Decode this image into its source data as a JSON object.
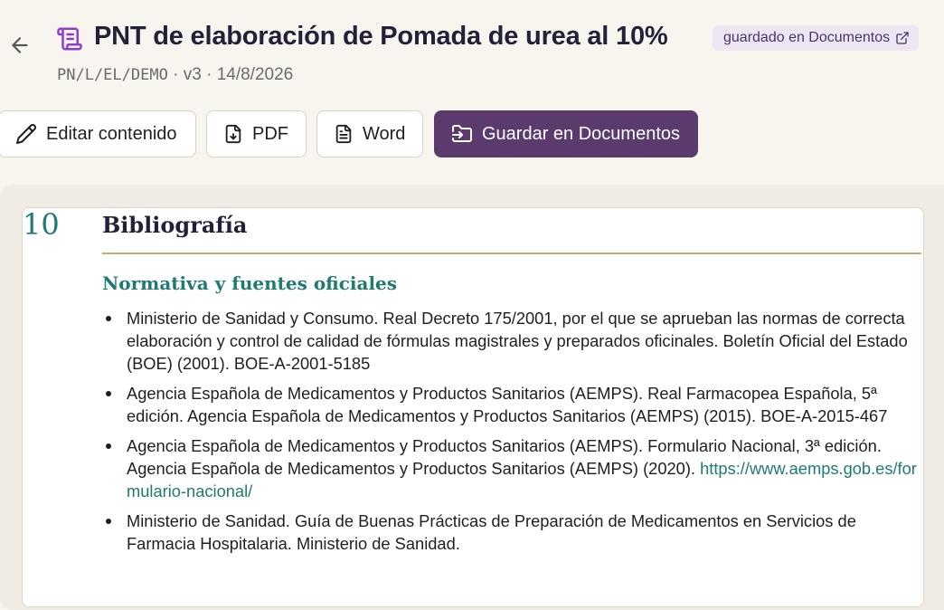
{
  "header": {
    "title": "PNT de elaboración de Pomada de urea al 10%",
    "saved_badge": "guardado en Documentos",
    "code": "PN/L/EL/DEMO",
    "version": "v3",
    "date": "14/8/2026",
    "separator": "·"
  },
  "toolbar": {
    "edit_label": "Editar contenido",
    "pdf_label": "PDF",
    "word_label": "Word",
    "save_label": "Guardar en Documentos"
  },
  "section": {
    "number": "10",
    "title": "Bibliografía",
    "subsection_title": "Normativa y fuentes oficiales",
    "references": [
      {
        "text": "Ministerio de Sanidad y Consumo. Real Decreto 175/2001, por el que se aprueban las normas de correcta elaboración y control de calidad de fórmulas magistrales y preparados oficinales. Boletín Oficial del Estado (BOE) (2001). BOE-A-2001-5185"
      },
      {
        "text": "Agencia Española de Medicamentos y Productos Sanitarios (AEMPS). Real Farmacopea Española, 5ª edición. Agencia Española de Medicamentos y Productos Sanitarios (AEMPS) (2015). BOE-A-2015-467"
      },
      {
        "text": "Agencia Española de Medicamentos y Productos Sanitarios (AEMPS). Formulario Nacional, 3ª edición. Agencia Española de Medicamentos y Productos Sanitarios (AEMPS) (2020). ",
        "link": "https://www.aemps.gob.es/formulario-nacional/"
      },
      {
        "text": "Ministerio de Sanidad. Guía de Buenas Prácticas de Preparación de Medicamentos en Servicios de Farmacia Hospitalaria. Ministerio de Sanidad."
      }
    ]
  },
  "icons": {
    "back": "arrow-left-icon",
    "document": "scroll-icon",
    "external": "external-link-icon",
    "edit": "pencil-icon",
    "pdf": "file-download-icon",
    "word": "file-text-icon",
    "save": "folder-input-icon"
  },
  "colors": {
    "accent": "#5b3a6e",
    "teal": "#1f7a72",
    "rule": "#c9a974",
    "badge_bg": "#efe6f4",
    "icon_purple": "#8b3fd1"
  }
}
